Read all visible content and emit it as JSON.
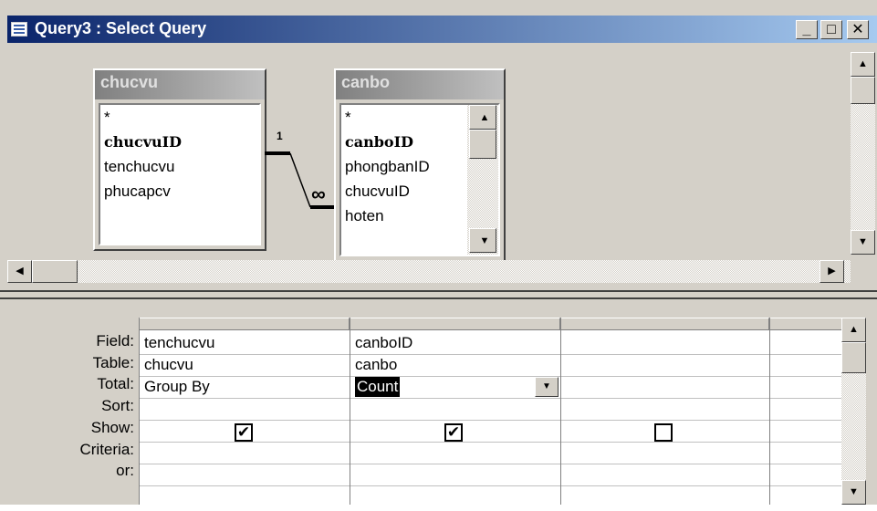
{
  "window": {
    "title": "Query3 : Select Query",
    "minimize_label": "_",
    "maximize_label": "□",
    "close_label": "✕"
  },
  "tables": [
    {
      "name": "chucvu",
      "fields": [
        "*",
        "chucvuID",
        "tenchucvu",
        "phucapcv"
      ]
    },
    {
      "name": "canbo",
      "fields": [
        "*",
        "canboID",
        "phongbanID",
        "chucvuID",
        "hoten"
      ]
    }
  ],
  "relationship": {
    "one_label": "1",
    "many_label": "∞"
  },
  "grid": {
    "row_labels": [
      "Field:",
      "Table:",
      "Total:",
      "Sort:",
      "Show:",
      "Criteria:",
      "or:"
    ],
    "columns": [
      {
        "field": "tenchucvu",
        "table": "chucvu",
        "total": "Group By",
        "show": true
      },
      {
        "field": "canboID",
        "table": "canbo",
        "total": "Count",
        "show": true
      },
      {
        "field": "",
        "table": "",
        "total": "",
        "show": false
      }
    ]
  },
  "icons": {
    "scroll_up": "▲",
    "scroll_down": "▼",
    "scroll_left": "◀",
    "scroll_right": "▶",
    "dropdown": "▼",
    "check": "✔"
  }
}
